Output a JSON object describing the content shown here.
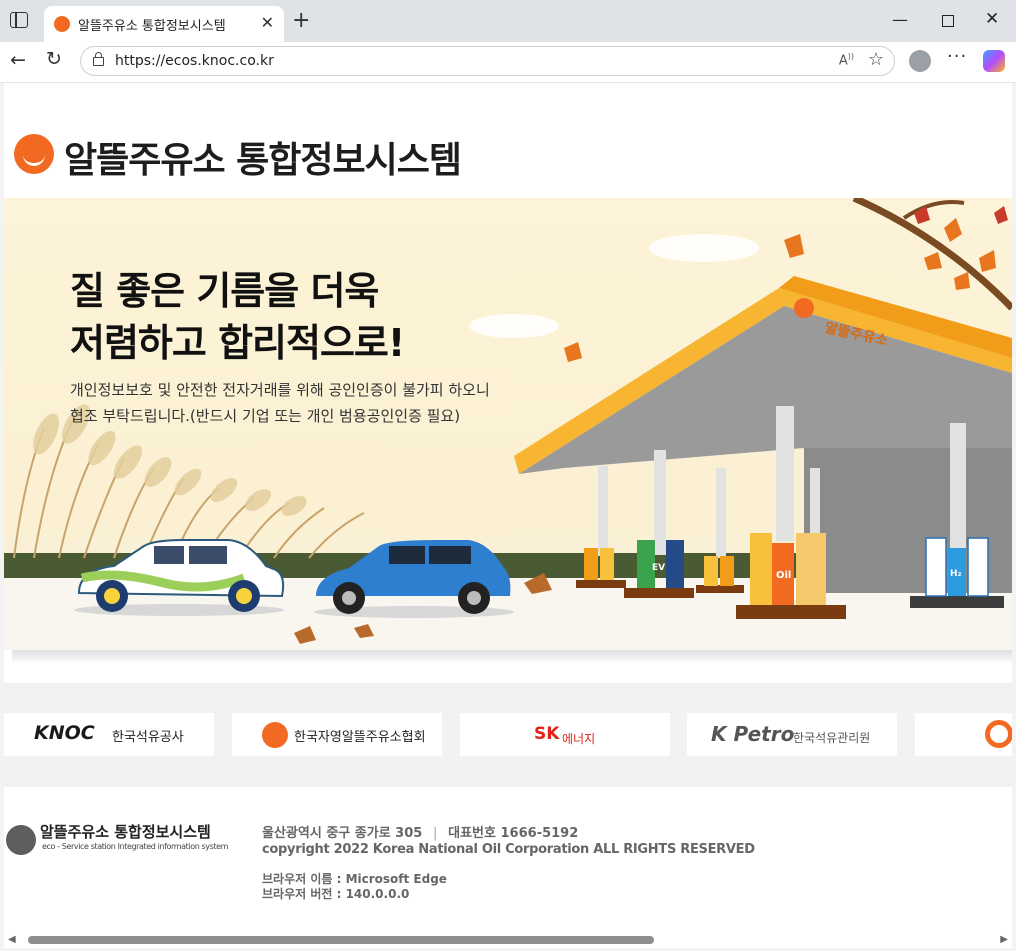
{
  "browser": {
    "tab_title": "알뜰주유소 통합정보시스템",
    "url": "https://ecos.knoc.co.kr"
  },
  "header": {
    "site_title": "알뜰주유소 통합정보시스템"
  },
  "hero": {
    "headline_line1": "질 좋은 기름을 더욱",
    "headline_line2": "저렴하고 합리적으로!",
    "notice_line1": "개인정보보호 및 안전한 전자거래를 위해 공인인증이 불가피 하오니",
    "notice_line2": "협조 부탁드립니다.(반드시 기업 또는 개인 범용공인인증 필요)",
    "canopy_text": "알뜰주유소",
    "pump_labels": {
      "ev": "EV",
      "oil": "Oil",
      "h2": "H₂"
    }
  },
  "partners": [
    {
      "logo_text": "KNOC",
      "name": "한국석유공사",
      "color": "#1a1a1a"
    },
    {
      "name": "한국자영알뜰주유소협회",
      "color": "#f26a22"
    },
    {
      "logo_text": "SK",
      "name": "에너지",
      "color": "#e2231a"
    },
    {
      "logo_text": "K Petro",
      "name": "한국석유관리원",
      "color": "#555555"
    }
  ],
  "footer": {
    "title": "알뜰주유소 통합정보시스템",
    "subtitle": "eco - Service station Integrated information system",
    "address": "울산광역시 중구 종가로 305",
    "phone": "대표번호 1666-5192",
    "copyright": "copyright 2022 Korea National Oil Corporation ALL RIGHTS RESERVED",
    "browser_name": "브라우저 이름 : Microsoft Edge",
    "browser_version": "브라우저 버전 : 140.0.0.0"
  },
  "colors": {
    "brand_orange": "#f26a22",
    "canopy_yellow": "#f7b531",
    "hero_bg": "#fcf3d8"
  }
}
